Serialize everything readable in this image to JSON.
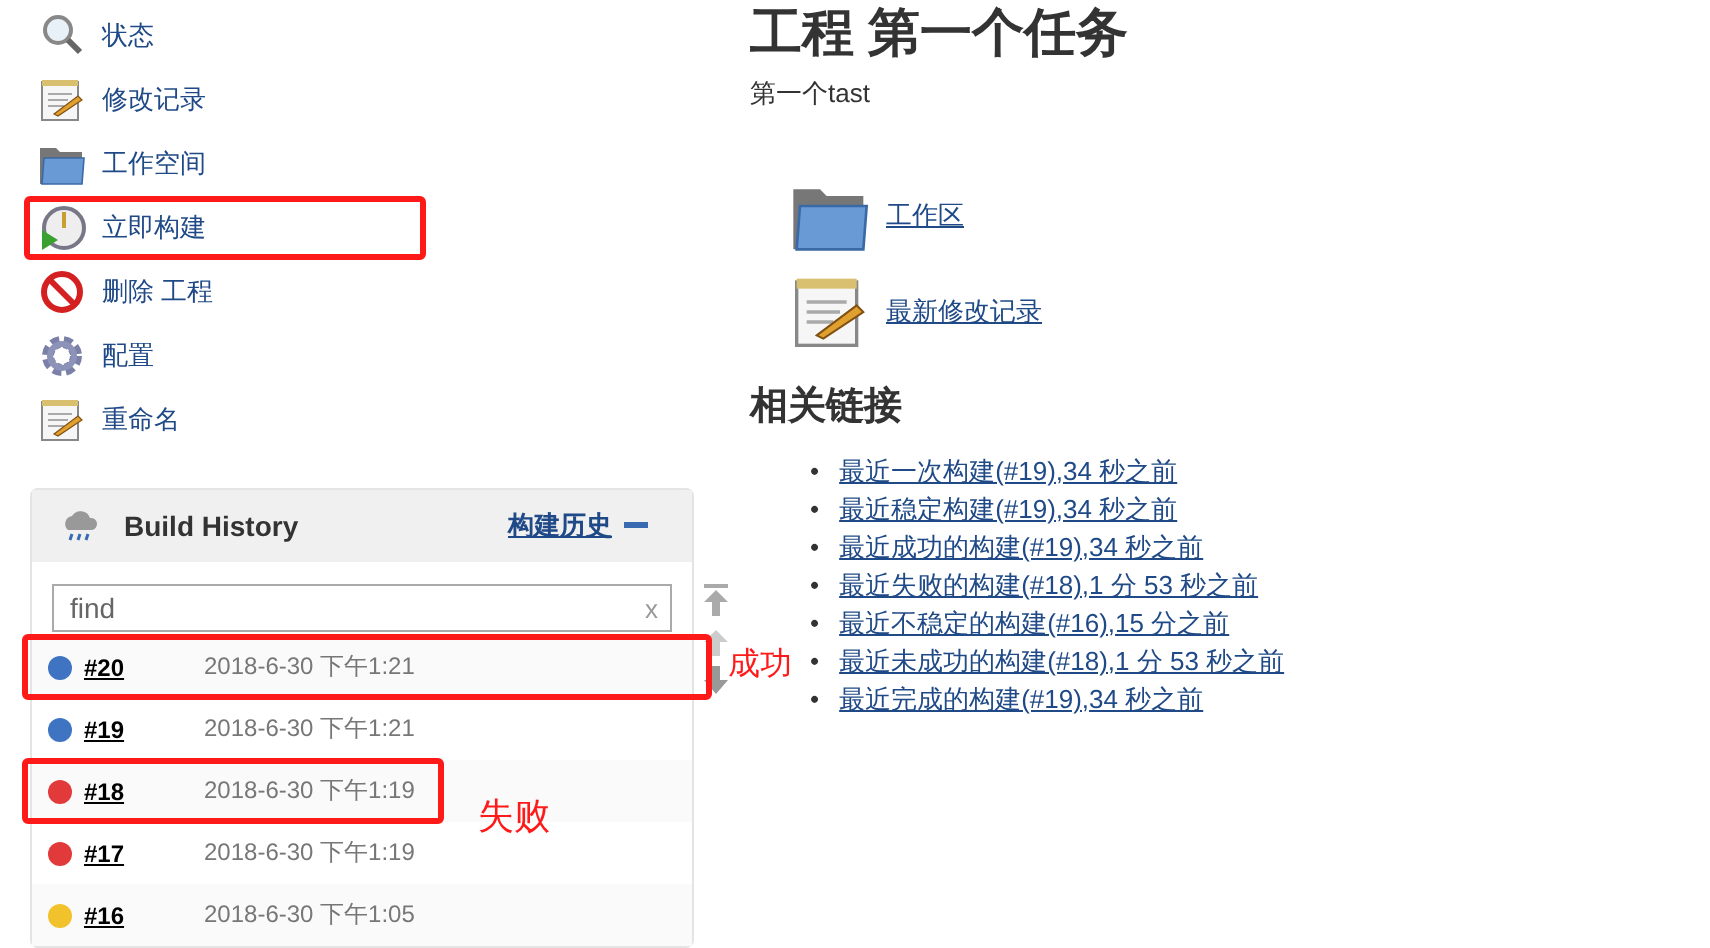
{
  "tasks": [
    {
      "kind": "search",
      "label": "状态",
      "highlighted": false
    },
    {
      "kind": "notepad",
      "label": "修改记录",
      "highlighted": false
    },
    {
      "kind": "folder",
      "label": "工作空间",
      "highlighted": false
    },
    {
      "kind": "clock",
      "label": "立即构建",
      "highlighted": true
    },
    {
      "kind": "forbidden",
      "label": "删除 工程",
      "highlighted": false
    },
    {
      "kind": "gear",
      "label": "配置",
      "highlighted": false
    },
    {
      "kind": "notepad",
      "label": "重命名",
      "highlighted": false
    }
  ],
  "build_history": {
    "title": "Build History",
    "trend_link": "构建历史",
    "search": {
      "placeholder": "find",
      "clear": "x"
    },
    "builds": [
      {
        "number": "#20",
        "time": "2018-6-30 下午1:21",
        "color": "#3f74c2",
        "kind": "wide",
        "highlighted": true,
        "note": "成功"
      },
      {
        "number": "#19",
        "time": "2018-6-30 下午1:21",
        "color": "#3f74c2"
      },
      {
        "number": "#18",
        "time": "2018-6-30 下午1:19",
        "color": "#e23a3a",
        "kind": "narrow",
        "highlighted": true,
        "note": "失败"
      },
      {
        "number": "#17",
        "time": "2018-6-30 下午1:19",
        "color": "#e23a3a"
      },
      {
        "number": "#16",
        "time": "2018-6-30 下午1:05",
        "color": "#f2c22c"
      }
    ]
  },
  "main": {
    "title": "工程 第一个任务",
    "description": "第一个tast",
    "shortcuts": [
      {
        "kind": "folder",
        "label": "工作区"
      },
      {
        "kind": "notepad",
        "label": "最新修改记录"
      }
    ],
    "list_marker": "•",
    "related_heading": "相关链接",
    "related_links": [
      "最近一次构建(#19),34 秒之前",
      "最近稳定构建(#19),34 秒之前",
      "最近成功的构建(#19),34 秒之前",
      "最近失败的构建(#18),1 分 53 秒之前",
      "最近不稳定的构建(#16),15 分之前",
      "最近未成功的构建(#18),1 分 53 秒之前",
      "最近完成的构建(#19),34 秒之前"
    ]
  }
}
